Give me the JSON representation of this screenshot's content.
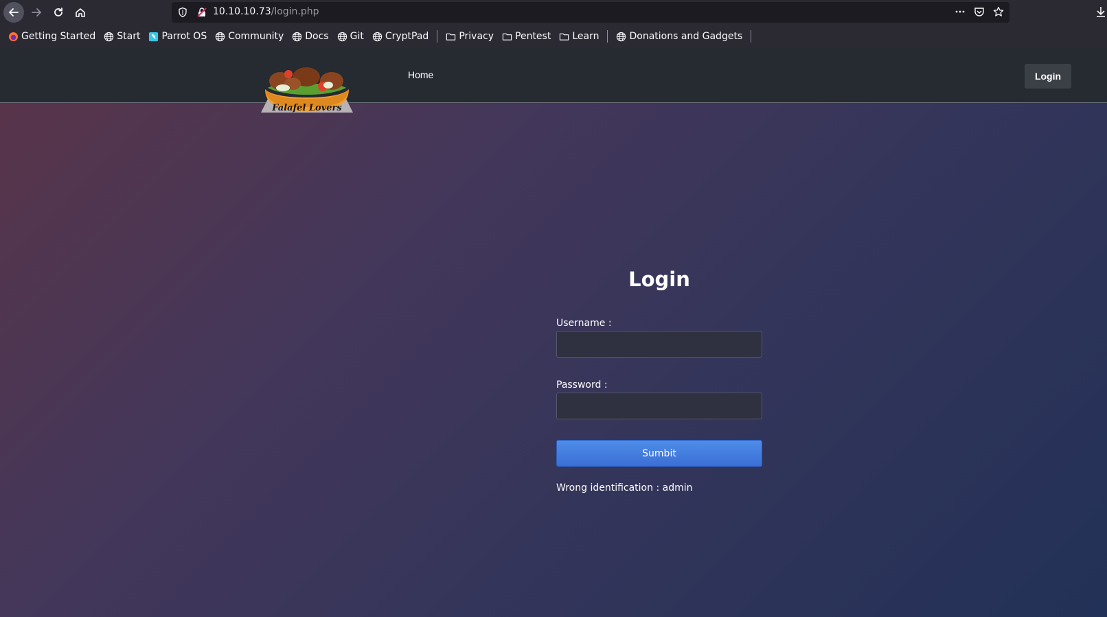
{
  "browser": {
    "url_host": "10.10.10.73",
    "url_path": "/login.php",
    "bookmarks": [
      {
        "label": "Getting Started",
        "icon": "firefox-icon"
      },
      {
        "label": "Start",
        "icon": "globe-icon"
      },
      {
        "label": "Parrot OS",
        "icon": "parrot-icon"
      },
      {
        "label": "Community",
        "icon": "globe-icon"
      },
      {
        "label": "Docs",
        "icon": "globe-icon"
      },
      {
        "label": "Git",
        "icon": "globe-icon"
      },
      {
        "label": "CryptPad",
        "icon": "globe-icon"
      },
      {
        "label": "Privacy",
        "icon": "folder-icon"
      },
      {
        "label": "Pentest",
        "icon": "folder-icon"
      },
      {
        "label": "Learn",
        "icon": "folder-icon"
      },
      {
        "label": "Donations and Gadgets",
        "icon": "globe-icon"
      }
    ]
  },
  "site": {
    "logo_text": "Falafel Lovers",
    "nav_home": "Home",
    "nav_login": "Login"
  },
  "form": {
    "title": "Login",
    "username_label": "Username :",
    "password_label": "Password :",
    "username_value": "",
    "password_value": "",
    "submit_label": "Sumbit",
    "error_message": "Wrong identification : admin"
  },
  "colors": {
    "accent": "#4f8de8",
    "header_bg": "#262a31"
  }
}
